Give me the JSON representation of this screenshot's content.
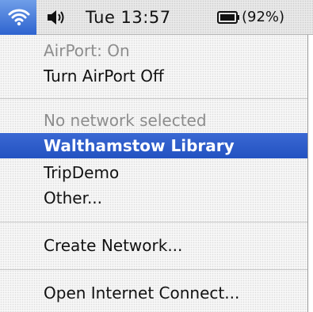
{
  "menubar": {
    "airport_icon": "wifi-airport-icon",
    "volume_icon": "speaker-volume-icon",
    "clock": "Tue 13:57",
    "battery_icon": "battery-icon",
    "battery_percent": "(92%)"
  },
  "airport_menu": {
    "status": "AirPort: On",
    "toggle": "Turn AirPort Off",
    "network_status": "No network selected",
    "networks": [
      "Walthamstow Library",
      "TripDemo",
      "Other..."
    ],
    "selected_network": "Walthamstow Library",
    "create_network": "Create Network...",
    "open_internet_connect": "Open Internet Connect..."
  },
  "colors": {
    "selection": "#2f5fca",
    "disabled_text": "#8d8d8d"
  }
}
